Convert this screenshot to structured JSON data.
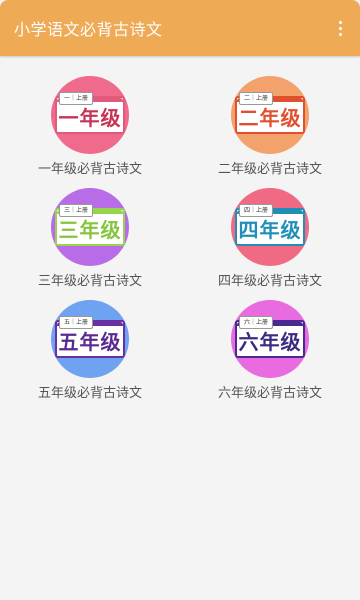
{
  "app": {
    "title": "小学语文必背古诗文"
  },
  "grades": [
    {
      "label": "一年级必背古诗文",
      "plate_text": "一年级",
      "tag_text": "一｜上册",
      "circle_color": "#f06a8c",
      "accent_color": "#e15a7b",
      "text_color": "#c83255"
    },
    {
      "label": "二年级必背古诗文",
      "plate_text": "二年级",
      "tag_text": "二｜上册",
      "circle_color": "#f2a26a",
      "accent_color": "#e0502f",
      "text_color": "#e0502f"
    },
    {
      "label": "三年级必背古诗文",
      "plate_text": "三年级",
      "tag_text": "三｜上册",
      "circle_color": "#b86ce8",
      "accent_color": "#98d54e",
      "text_color": "#86c43e"
    },
    {
      "label": "四年级必背古诗文",
      "plate_text": "四年级",
      "tag_text": "四｜上册",
      "circle_color": "#f06a84",
      "accent_color": "#1f8fb8",
      "text_color": "#1f8fb8"
    },
    {
      "label": "五年级必背古诗文",
      "plate_text": "五年级",
      "tag_text": "五｜上册",
      "circle_color": "#6fa2f0",
      "accent_color": "#6a2fa0",
      "text_color": "#5a2a90"
    },
    {
      "label": "六年级必背古诗文",
      "plate_text": "六年级",
      "tag_text": "六｜上册",
      "circle_color": "#e86be0",
      "accent_color": "#4a2a90",
      "text_color": "#3a2a80"
    }
  ]
}
